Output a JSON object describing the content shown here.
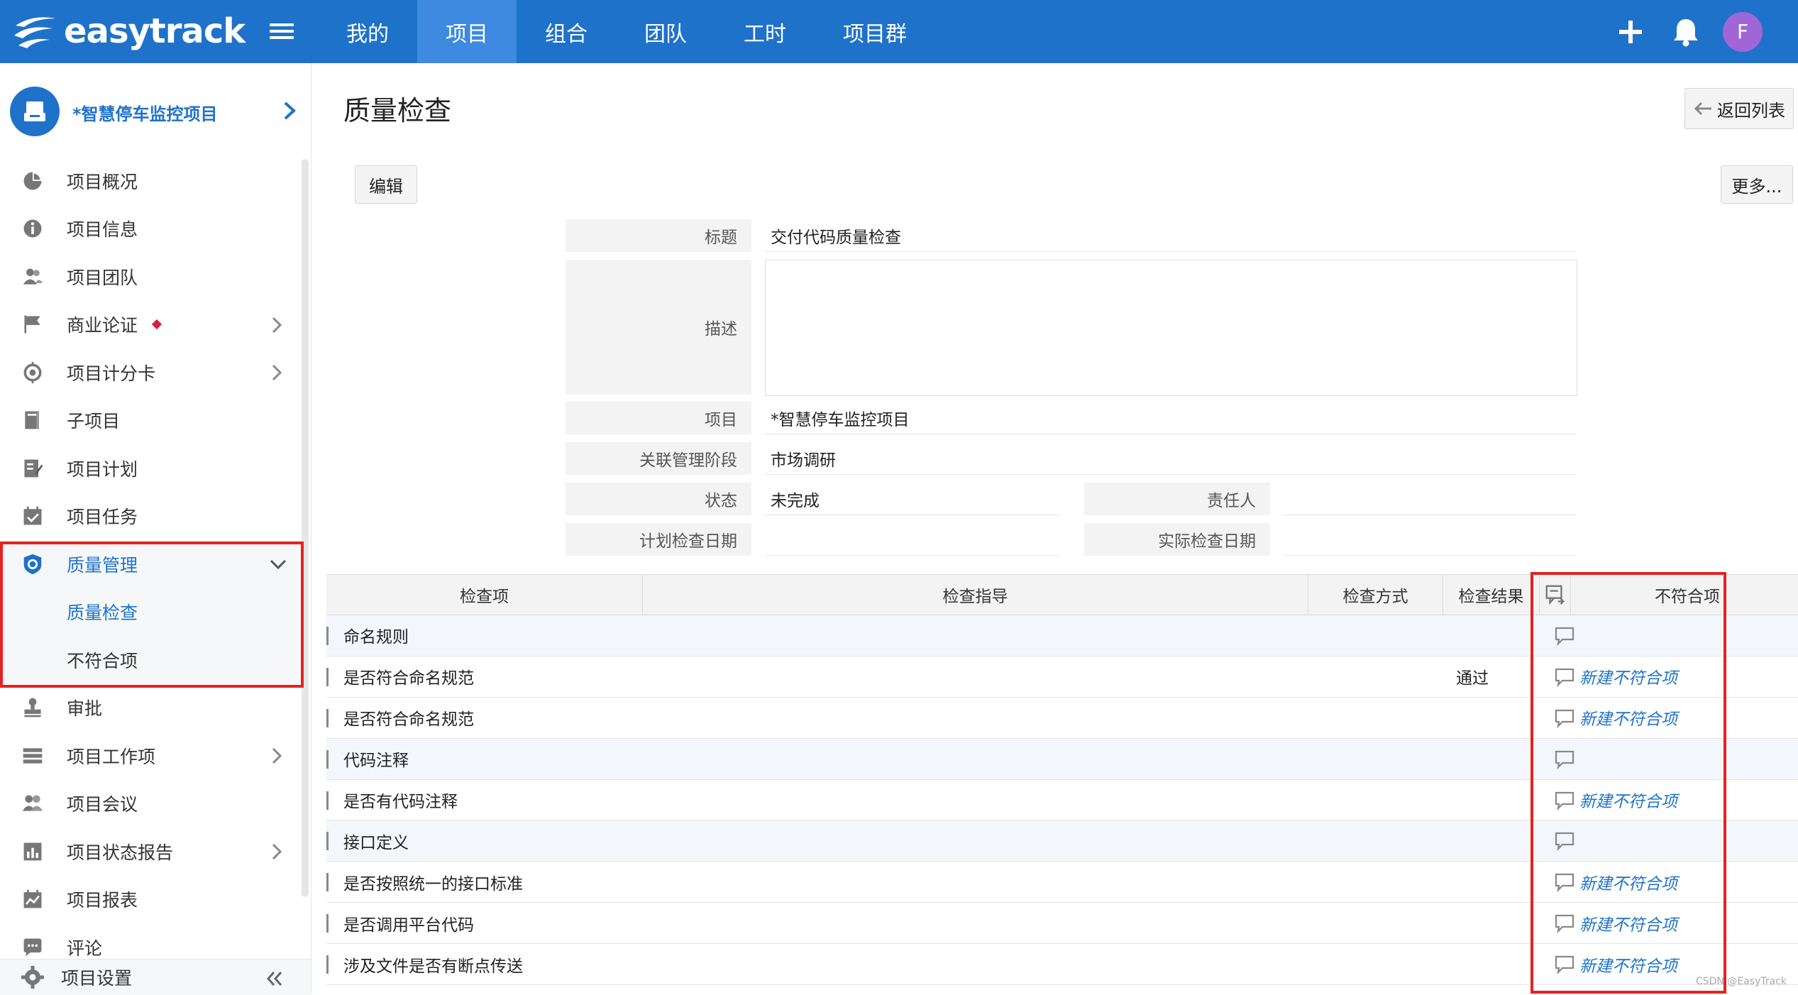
{
  "topbar": {
    "logo_text": "easytrack",
    "nav": [
      {
        "label": "我的",
        "active": false
      },
      {
        "label": "项目",
        "active": true
      },
      {
        "label": "组合",
        "active": false
      },
      {
        "label": "团队",
        "active": false
      },
      {
        "label": "工时",
        "active": false
      },
      {
        "label": "项目群",
        "active": false
      }
    ],
    "avatar_letter": "F",
    "avatar_color": "#a066d8",
    "brand_color": "#1f72c9"
  },
  "sidebar": {
    "project_name": "*智慧停车监控项目",
    "items": [
      {
        "label": "项目概况",
        "icon": "pie-chart-icon"
      },
      {
        "label": "项目信息",
        "icon": "info-icon"
      },
      {
        "label": "项目团队",
        "icon": "team-icon"
      },
      {
        "label": "商业论证",
        "icon": "flag-icon",
        "chevron": true,
        "badge": true
      },
      {
        "label": "项目计分卡",
        "icon": "target-icon",
        "chevron": true
      },
      {
        "label": "子项目",
        "icon": "book-icon"
      },
      {
        "label": "项目计划",
        "icon": "plan-icon"
      },
      {
        "label": "项目任务",
        "icon": "calendar-check-icon"
      },
      {
        "label": "质量管理",
        "icon": "shield-icon",
        "expanded": true
      },
      {
        "label": "质量检查",
        "sub": true,
        "current": true
      },
      {
        "label": "不符合项",
        "sub": true
      },
      {
        "label": "审批",
        "icon": "stamp-icon"
      },
      {
        "label": "项目工作项",
        "icon": "list-icon",
        "chevron": true
      },
      {
        "label": "项目会议",
        "icon": "meeting-icon"
      },
      {
        "label": "项目状态报告",
        "icon": "report-icon",
        "chevron": true
      },
      {
        "label": "项目报表",
        "icon": "chart-report-icon"
      },
      {
        "label": "评论",
        "icon": "comment-icon"
      }
    ],
    "settings_label": "项目设置"
  },
  "main": {
    "title": "质量检查",
    "back_label": "返回列表",
    "edit_label": "编辑",
    "more_label": "更多...",
    "form": {
      "title_label": "标题",
      "title_value": "交付代码质量检查",
      "desc_label": "描述",
      "desc_value": "",
      "project_label": "项目",
      "project_value": "*智慧停车监控项目",
      "phase_label": "关联管理阶段",
      "phase_value": "市场调研",
      "status_label": "状态",
      "status_value": "未完成",
      "owner_label": "责任人",
      "owner_value": "",
      "plan_date_label": "计划检查日期",
      "plan_date_value": "",
      "actual_date_label": "实际检查日期",
      "actual_date_value": ""
    },
    "table": {
      "headers": [
        "检查项",
        "检查指导",
        "检查方式",
        "检查结果",
        "不符合项"
      ],
      "rows": [
        {
          "item": "命名规则",
          "group": true,
          "result": "",
          "nc": ""
        },
        {
          "item": "是否符合命名规范",
          "group": false,
          "result": "通过",
          "nc": "新建不符合项"
        },
        {
          "item": "是否符合命名规范",
          "group": false,
          "result": "",
          "nc": "新建不符合项"
        },
        {
          "item": "代码注释",
          "group": true,
          "result": "",
          "nc": ""
        },
        {
          "item": "是否有代码注释",
          "group": false,
          "result": "",
          "nc": "新建不符合项"
        },
        {
          "item": "接口定义",
          "group": true,
          "result": "",
          "nc": ""
        },
        {
          "item": "是否按照统一的接口标准",
          "group": false,
          "result": "",
          "nc": "新建不符合项"
        },
        {
          "item": "是否调用平台代码",
          "group": false,
          "result": "",
          "nc": "新建不符合项"
        },
        {
          "item": "涉及文件是否有断点传送",
          "group": false,
          "result": "",
          "nc": "新建不符合项"
        }
      ]
    },
    "watermark": "CSDN @EasyTrack"
  }
}
